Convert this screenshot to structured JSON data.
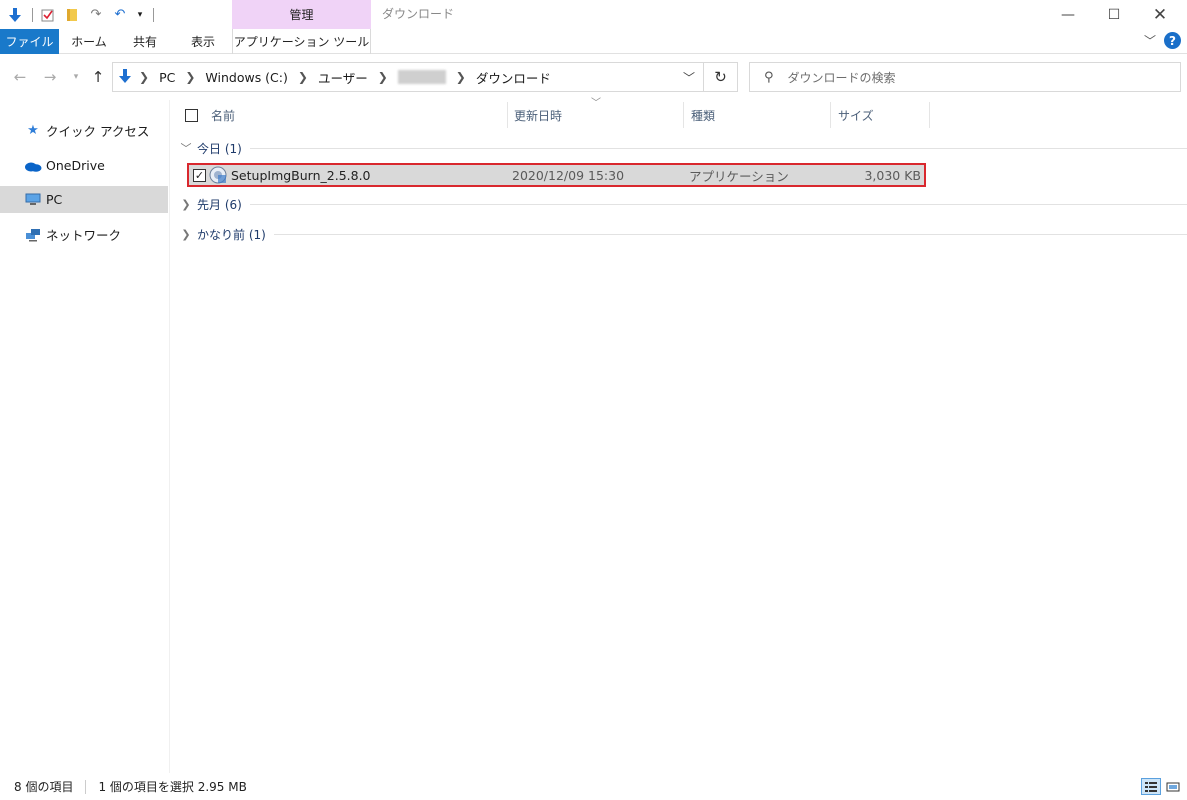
{
  "titlebar": {
    "context_tab_group": "管理",
    "window_title": "ダウンロード"
  },
  "ribbon": {
    "tabs": [
      {
        "label": "ファイル"
      },
      {
        "label": "ホーム"
      },
      {
        "label": "共有"
      },
      {
        "label": "表示"
      },
      {
        "label": "アプリケーション ツール"
      }
    ]
  },
  "address": {
    "breadcrumbs": [
      "PC",
      "Windows (C:)",
      "ユーザー",
      "ダウンロード"
    ],
    "search_placeholder": "ダウンロードの検索"
  },
  "nav": {
    "items": [
      {
        "label": "クイック アクセス",
        "icon": "star-icon"
      },
      {
        "label": "OneDrive",
        "icon": "cloud-icon"
      },
      {
        "label": "PC",
        "icon": "computer-icon",
        "selected": true
      },
      {
        "label": "ネットワーク",
        "icon": "network-icon"
      }
    ]
  },
  "columns": {
    "name": "名前",
    "modified": "更新日時",
    "type": "種類",
    "size": "サイズ"
  },
  "groups": [
    {
      "label": "今日 (1)",
      "expanded": true
    },
    {
      "label": "先月 (6)",
      "expanded": false
    },
    {
      "label": "かなり前 (1)",
      "expanded": false
    }
  ],
  "files": [
    {
      "name": "SetupImgBurn_2.5.8.0",
      "modified": "2020/12/09 15:30",
      "type": "アプリケーション",
      "size": "3,030 KB",
      "checked": true
    }
  ],
  "status": {
    "item_count": "8 個の項目",
    "selection": "1 個の項目を選択  2.95 MB"
  },
  "colors": {
    "file_tab": "#1979ca",
    "context_tab": "#f0d3f7",
    "selection_outline": "#d9282e"
  }
}
